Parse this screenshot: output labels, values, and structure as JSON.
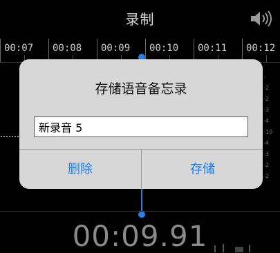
{
  "header": {
    "title": "录制",
    "speaker_icon": "speaker-icon"
  },
  "timeline": {
    "labels": [
      "00:07",
      "00:08",
      "00:09",
      "00:10",
      "00:11",
      "00:12"
    ]
  },
  "level_scale": [
    "-",
    "-2",
    "-2",
    "-3",
    "-4",
    "-10",
    "-4",
    "-3",
    "-2",
    "-2"
  ],
  "timer": "00:09.91",
  "dialog": {
    "title": "存储语音备忘录",
    "input_value": "新录音 5",
    "delete_label": "删除",
    "save_label": "存储"
  },
  "colors": {
    "accent": "#1e7ef0",
    "playhead": "#2a7de1",
    "background": "#000000",
    "dialog": "#d7d7d7"
  }
}
